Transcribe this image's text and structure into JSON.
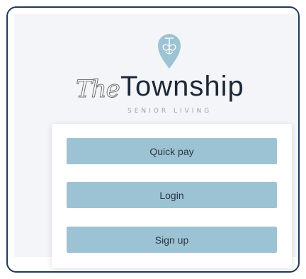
{
  "brand": {
    "the_text": "The",
    "name": "Township",
    "tagline": "SENIOR LIVING",
    "logo_icon": "droplet-ornament-icon",
    "pin_color": "#9cc3d4"
  },
  "actions": {
    "quick_pay_label": "Quick pay",
    "login_label": "Login",
    "signup_label": "Sign up"
  },
  "colors": {
    "frame_border": "#1f3a5c",
    "button_bg": "#9cc3d4",
    "text_dark": "#1d2838"
  }
}
